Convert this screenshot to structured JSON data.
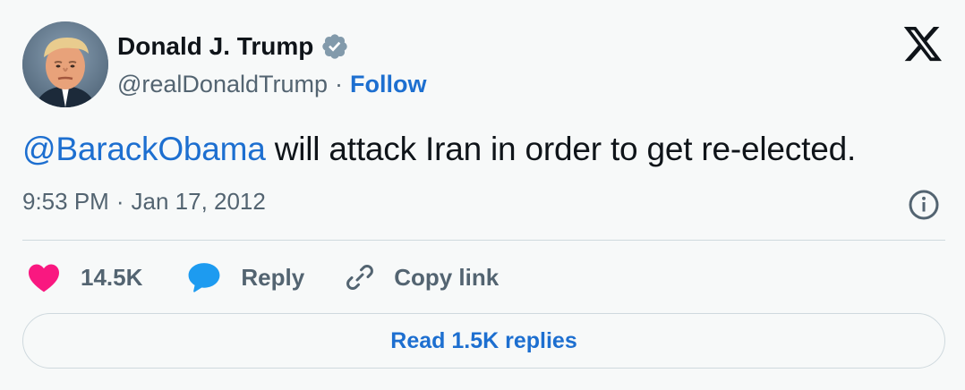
{
  "author": {
    "display_name": "Donald J. Trump",
    "handle": "@realDonaldTrump",
    "verified_icon": "verified-badge-icon",
    "separator": "·",
    "follow_label": "Follow"
  },
  "tweet": {
    "mention": "@BarackObama",
    "text": " will attack Iran in order to get re-elected.",
    "time": "9:53 PM",
    "separator": "·",
    "date": "Jan 17, 2012"
  },
  "actions": {
    "likes_count": "14.5K",
    "reply_label": "Reply",
    "copy_link_label": "Copy link"
  },
  "footer": {
    "read_replies_label": "Read 1.5K replies"
  },
  "colors": {
    "accent": "#1d6fd0",
    "like": "#f91880",
    "reply": "#1d9bf0",
    "verified": "#829aab",
    "text_primary": "#0f1419",
    "text_secondary": "#536471"
  }
}
